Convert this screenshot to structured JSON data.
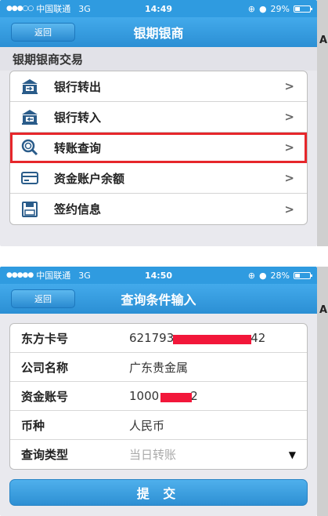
{
  "screen1": {
    "status": {
      "dots": "●●●○○",
      "carrier": "中国联通",
      "network": "3G",
      "time": "14:49",
      "battery": "29%"
    },
    "nav": {
      "back": "返回",
      "title": "银期银商"
    },
    "section": "银期银商交易",
    "items": [
      {
        "label": "银行转出",
        "icon": "bank-out-icon"
      },
      {
        "label": "银行转入",
        "icon": "bank-in-icon"
      },
      {
        "label": "转账查询",
        "icon": "magnifier-icon",
        "highlighted": true
      },
      {
        "label": "资金账户余额",
        "icon": "card-icon"
      },
      {
        "label": "签约信息",
        "icon": "floppy-disk-icon"
      }
    ],
    "chevron": ">"
  },
  "screen2": {
    "status": {
      "dots": "●●●●●",
      "carrier": "中国联通",
      "network": "3G",
      "time": "14:50",
      "battery": "28%"
    },
    "nav": {
      "back": "返回",
      "title": "查询条件输入"
    },
    "fields": [
      {
        "label": "东方卡号",
        "value_prefix": "621793",
        "value_suffix": "42"
      },
      {
        "label": "公司名称",
        "value": "广东贵金属"
      },
      {
        "label": "资金账号",
        "value_prefix": "1000",
        "value_suffix": "2"
      },
      {
        "label": "币种",
        "value": "人民币"
      },
      {
        "label": "查询类型",
        "value": "当日转账"
      }
    ],
    "dropdown_arrow": "▼",
    "submit": "提 交"
  },
  "side_letter": "A",
  "colors": {
    "navbar": "#2f9be0",
    "highlight": "#e6262b",
    "redaction": "#f2173a",
    "icon": "#2a5c8a"
  }
}
